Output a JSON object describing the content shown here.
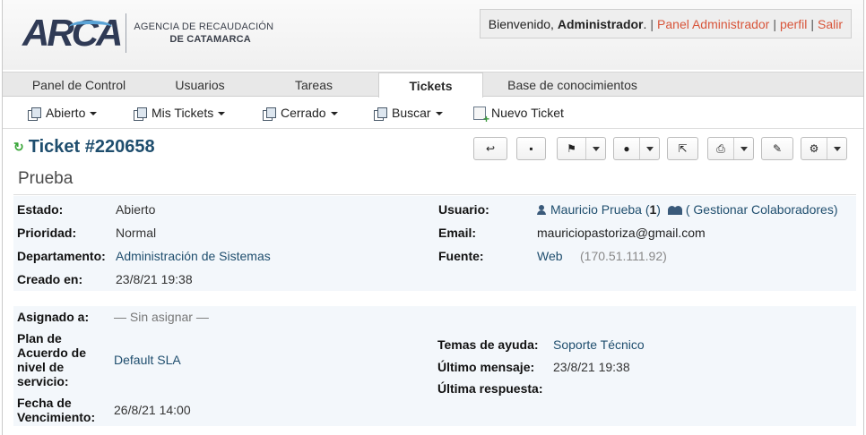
{
  "header": {
    "logo_mark": "ARCA",
    "logo_line1": "AGENCIA DE RECAUDACIÓN",
    "logo_line2": "DE CATAMARCA",
    "welcome_prefix": "Bienvenido,",
    "welcome_user": "Administrador",
    "welcome_suffix": ".",
    "links": {
      "admin_panel": "Panel Administrador",
      "profile": "perfil",
      "logout": "Salir"
    },
    "separator": "|"
  },
  "tabs": [
    {
      "label": "Panel de Control"
    },
    {
      "label": "Usuarios"
    },
    {
      "label": "Tareas"
    },
    {
      "label": "Tickets",
      "active": true
    },
    {
      "label": "Base de conocimientos"
    }
  ],
  "subnav": {
    "open": "Abierto",
    "my_tickets": "Mis Tickets",
    "closed": "Cerrado",
    "search": "Buscar",
    "new_ticket": "Nuevo Ticket"
  },
  "ticket": {
    "number": "Ticket #220658",
    "subject": "Prueba"
  },
  "details": {
    "status_label": "Estado:",
    "status": "Abierto",
    "priority_label": "Prioridad:",
    "priority": "Normal",
    "department_label": "Departamento:",
    "department": "Administración de Sistemas",
    "created_label": "Creado en:",
    "created": "23/8/21 19:38",
    "user_label": "Usuario:",
    "user_name": "Mauricio Prueba",
    "user_count_open": "(",
    "user_count": "1",
    "user_count_close": ")",
    "collaborators": "( Gestionar Colaboradores)",
    "email_label": "Email:",
    "email": "mauriciopastoriza@gmail.com",
    "source_label": "Fuente:",
    "source": "Web",
    "source_ip": "(170.51.111.92)",
    "assigned_label": "Asignado a:",
    "assigned": "— Sin asignar —",
    "sla_label_1": "Plan de",
    "sla_label_2": "Acuerdo de",
    "sla_label_3": "nivel de",
    "sla_label_4": "servicio:",
    "sla": "Default SLA",
    "due_label_1": "Fecha de",
    "due_label_2": "Vencimiento:",
    "due": "26/8/21 14:00",
    "help_topic_label": "Temas de ayuda:",
    "help_topic": "Soporte Técnico",
    "last_message_label": "Último mensaje:",
    "last_message": "23/8/21 19:38",
    "last_response_label": "Última respuesta:",
    "last_response": ""
  },
  "colors": {
    "accent_link": "#d8553a",
    "title_blue": "#1f4e6e",
    "panel_bg": "#f3f7fb"
  }
}
